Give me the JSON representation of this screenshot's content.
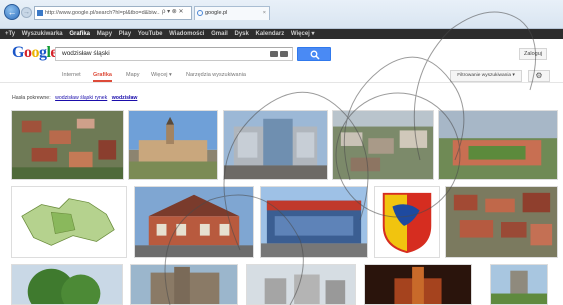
{
  "browser": {
    "address": "http://www.google.pl/search?hl=pl&tbo=d&biw...",
    "address_controls": "ρ ▾ ⊗ ✕",
    "tab_title": "google.pl",
    "tab_close": "×"
  },
  "google_bar": {
    "items": [
      "+Ty",
      "Wyszukiwarka",
      "Grafika",
      "Mapy",
      "Play",
      "YouTube",
      "Wiadomości",
      "Gmail",
      "Dysk",
      "Kalendarz",
      "Więcej ▾"
    ]
  },
  "logo": {
    "letters": [
      "G",
      "o",
      "o",
      "g",
      "l",
      "e"
    ]
  },
  "search": {
    "query": "wodzisław śląski"
  },
  "login_label": "Zaloguj",
  "types": {
    "items": [
      "Internet",
      "Grafika",
      "Mapy",
      "Więcej ▾",
      "Narzędzia wyszukiwania"
    ]
  },
  "filter_label": "Filtrowanie wyszukiwania ▾",
  "gear": "⚙",
  "related": {
    "prefix": "Hasła pokrewne:",
    "links": [
      "wodzisław śląski rynek",
      "wodzisław"
    ]
  },
  "colors": {
    "accent_red": "#dd4b39",
    "search_blue": "#4a8af4",
    "link_blue": "#1a0dab"
  }
}
